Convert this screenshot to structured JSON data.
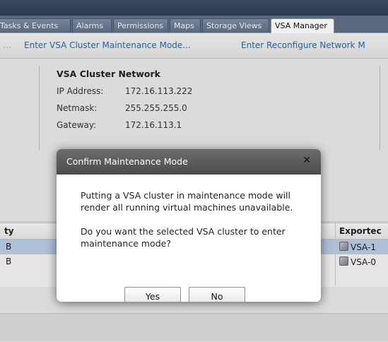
{
  "tabs": [
    {
      "label": "Tasks & Events"
    },
    {
      "label": "Alarms"
    },
    {
      "label": "Permissions"
    },
    {
      "label": "Maps"
    },
    {
      "label": "Storage Views"
    },
    {
      "label": "VSA Manager"
    }
  ],
  "actions": {
    "truncated": "...",
    "enter_maintenance": "Enter VSA Cluster Maintenance Mode...",
    "enter_reconfigure": "Enter Reconfigure Network M"
  },
  "network": {
    "title": "VSA Cluster Network",
    "ip_label": "IP Address:",
    "ip_value": "172.16.113.222",
    "netmask_label": "Netmask:",
    "netmask_value": "255.255.255.0",
    "gateway_label": "Gateway:",
    "gateway_value": "172.16.113.1"
  },
  "table": {
    "col_capacity": "ty",
    "col_exported": "Exportec",
    "rows": [
      {
        "capacity": "B",
        "exported": "VSA-1"
      },
      {
        "capacity": "B",
        "exported": "VSA-0"
      }
    ]
  },
  "dialog": {
    "title": "Confirm Maintenance Mode",
    "close": "✕",
    "message1": "Putting a VSA cluster in maintenance mode will render all running virtual machines unavailable.",
    "message2": "Do you want the selected VSA cluster to enter maintenance mode?",
    "yes": "Yes",
    "no": "No"
  }
}
